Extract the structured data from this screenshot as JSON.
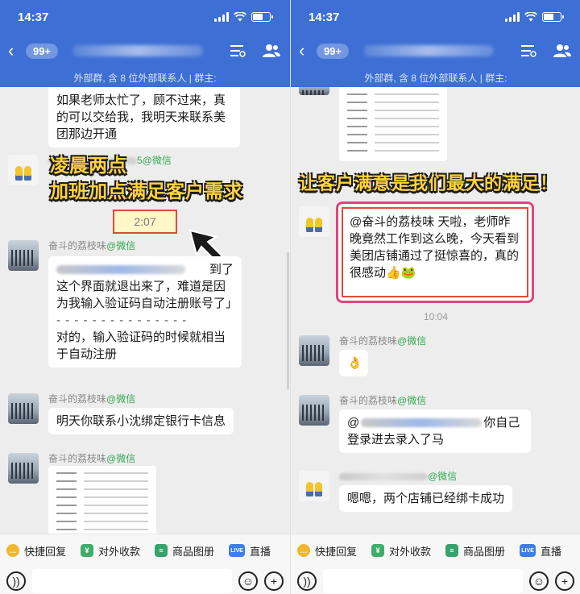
{
  "status": {
    "time": "14:37"
  },
  "header": {
    "badge": "99+",
    "subtitle": "外部群, 含 8 位外部联系人 | 群主: "
  },
  "left": {
    "msg_top": "如果老师太忙了，顾不过来，真的可以交给我，我明天来联系美团那边开通",
    "sender_top_suffix": "5@微信",
    "caption_line1": "凌晨两点",
    "caption_line2": "加班加点满足客户需求",
    "timestamp": "2:07",
    "sender_name": "奋斗的荔枝味",
    "wechat_tag": "@微信",
    "quote_tail": "到了",
    "quote_body": "这个界面就退出来了，难道是因为我输入验证码自动注册账号了」",
    "divider": "- - - - - - - - - - - - - - -",
    "reply": "对的，输入验证码的时候就相当于自动注册",
    "msg_bank": "明天你联系小沈绑定银行卡信息"
  },
  "right": {
    "caption": "让客户满意是我们最大的满足！",
    "msg_highlight": "@奋斗的荔枝味 天啦，老师昨晚竟然工作到这么晚，今天看到美团店铺通过了挺惊喜的，真的很感动👍🐸",
    "timestamp": "10:04",
    "sender_name": "奋斗的荔枝味",
    "wechat_tag": "@微信",
    "msg_emoji": "👌",
    "msg_login_head": "@",
    "msg_login_tail": "你自己",
    "msg_login_line2": "登录进去录入了马",
    "msg_success": "嗯嗯，两个店铺已经绑卡成功"
  },
  "toolbar": {
    "quick_reply": "快捷回复",
    "collect": "对外收款",
    "catalog": "商品图册",
    "live": "直播",
    "live_badge": "LIVE"
  }
}
